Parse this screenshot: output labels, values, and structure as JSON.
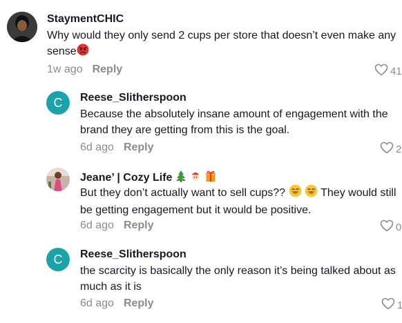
{
  "comments": [
    {
      "username": "StaymentCHIC",
      "text": "Why would they only send 2 cups per store that doesn’t even make any sense",
      "time": "1w ago",
      "reply_label": "Reply",
      "likes": "41"
    },
    {
      "avatar_letter": "C",
      "username": "Reese_Slitherspoon",
      "text": "Because the absolutely insane amount of engagement with the brand they are getting from this is the goal.",
      "time": "6d ago",
      "reply_label": "Reply",
      "likes": "2"
    },
    {
      "username": "Jeane’ | Cozy Life",
      "text_a": "But they don’t actually want to sell cups??",
      "text_b": "They would still be getting engagement but it would be positive.",
      "time": "6d ago",
      "reply_label": "Reply",
      "likes": "0"
    },
    {
      "avatar_letter": "C",
      "username": "Reese_Slitherspoon",
      "text": "the scarcity is basically the only reason it’s being talked about as much as it is",
      "time": "6d ago",
      "reply_label": "Reply",
      "likes": "1"
    }
  ],
  "colors": {
    "avatar_teal": "#1aa3a9",
    "meta_gray": "#8a8b91",
    "text": "#161823"
  },
  "icons": [
    "angry-face-emoji",
    "christmas-tree-emoji",
    "santa-emoji",
    "gift-emoji",
    "grinning-sweat-emoji",
    "heart-outline-icon"
  ]
}
